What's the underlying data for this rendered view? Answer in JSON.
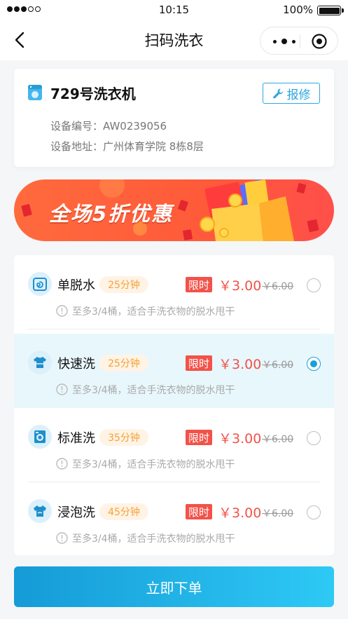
{
  "status_bar": {
    "time": "10:15",
    "battery": "100%",
    "signal_bars": 3
  },
  "nav": {
    "title": "扫码洗衣"
  },
  "device": {
    "name": "729号洗衣机",
    "repair_label": "报修",
    "code_line": "设备编号：AW0239056",
    "address_line": "设备地址：广州体育学院 8栋8层"
  },
  "banner": {
    "text": "全场5折优惠"
  },
  "options": [
    {
      "name": "单脱水",
      "duration": "25分钟",
      "limit_tag": "限时",
      "price": "￥3.00",
      "old_price": "￥6.00",
      "note": "至多3/4桶，适合手洗衣物的脱水甩干",
      "icon": "spin-icon",
      "selected": false
    },
    {
      "name": "快速洗",
      "duration": "25分钟",
      "limit_tag": "限时",
      "price": "￥3.00",
      "old_price": "￥6.00",
      "note": "至多3/4桶，适合手洗衣物的脱水甩干",
      "icon": "shirt-icon",
      "selected": true
    },
    {
      "name": "标准洗",
      "duration": "35分钟",
      "limit_tag": "限时",
      "price": "￥3.00",
      "old_price": "￥6.00",
      "note": "至多3/4桶，适合手洗衣物的脱水甩干",
      "icon": "washer-icon",
      "selected": false
    },
    {
      "name": "浸泡洗",
      "duration": "45分钟",
      "limit_tag": "限时",
      "price": "￥3.00",
      "old_price": "￥6.00",
      "note": "至多3/4桶，适合手洗衣物的脱水甩干",
      "icon": "tshirt-icon",
      "selected": false
    }
  ],
  "submit": {
    "label": "立即下单"
  },
  "colors": {
    "accent": "#1aa0d8",
    "price": "#f2524a",
    "duration": "#f6a234",
    "banner": "#ff5a3a"
  }
}
